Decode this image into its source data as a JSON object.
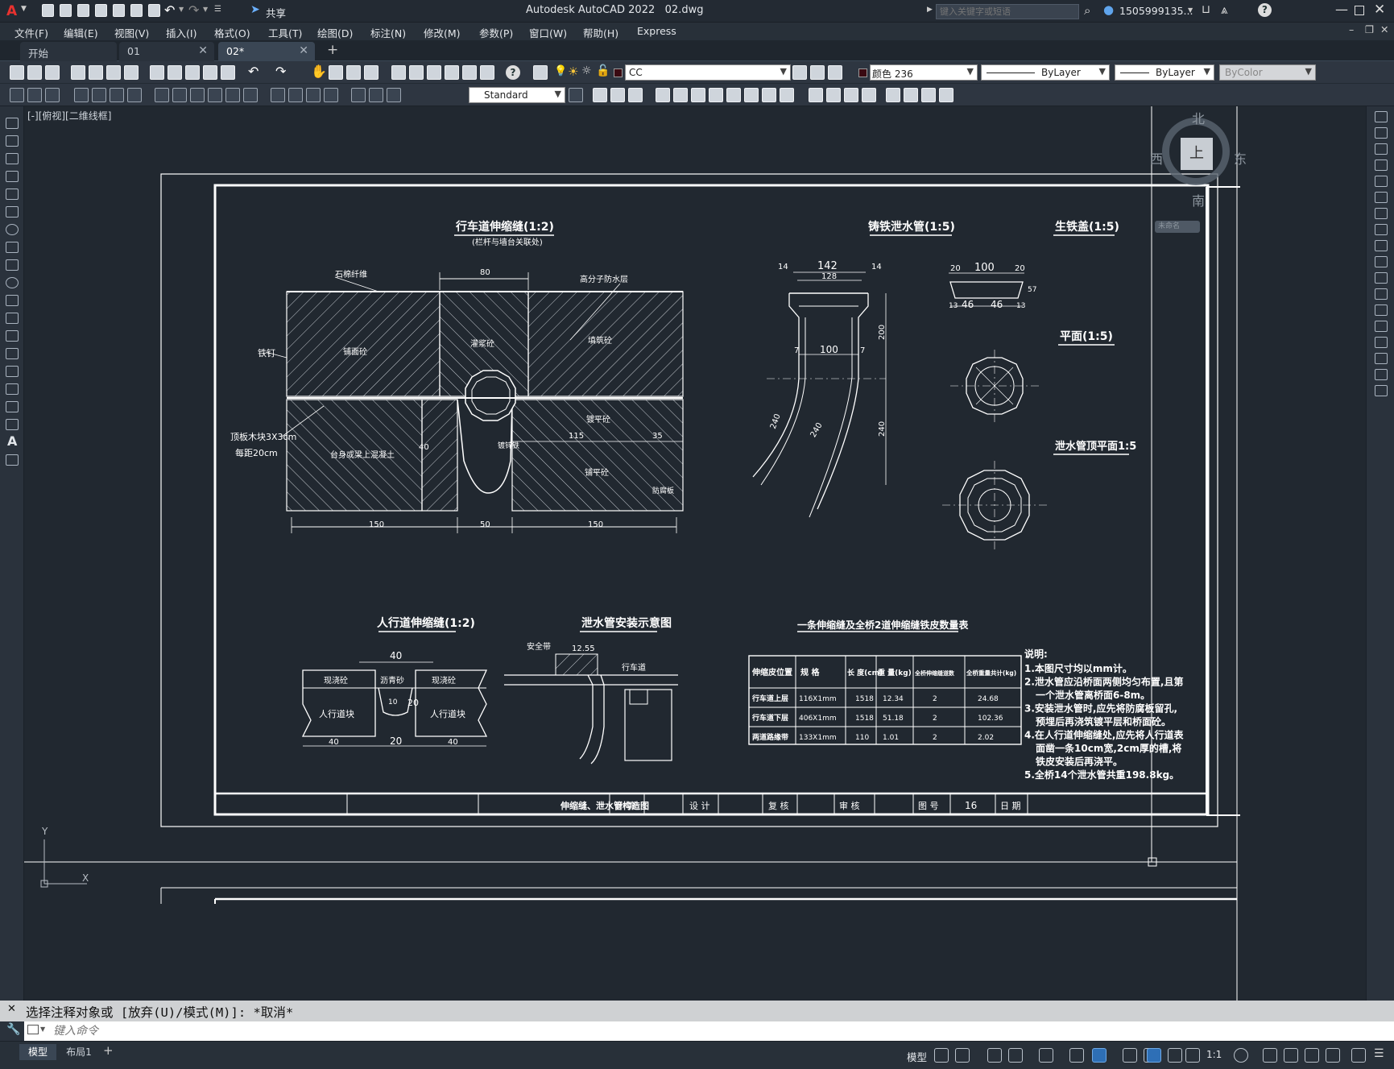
{
  "app": {
    "title": "Autodesk AutoCAD 2022",
    "file": "02.dwg",
    "search_placeholder": "键入关键字或短语",
    "user": "1505999135...",
    "share": "共享"
  },
  "menu": [
    "文件(F)",
    "编辑(E)",
    "视图(V)",
    "插入(I)",
    "格式(O)",
    "工具(T)",
    "绘图(D)",
    "标注(N)",
    "修改(M)",
    "参数(P)",
    "窗口(W)",
    "帮助(H)",
    "Express"
  ],
  "tabs": [
    {
      "label": "开始"
    },
    {
      "label": "01"
    },
    {
      "label": "02*"
    }
  ],
  "toolbar": {
    "layer": "CC",
    "color": "颜色 236",
    "linetype": "ByLayer",
    "lineweight": "ByLayer",
    "plotstyle": "ByColor",
    "textstyle": "Standard"
  },
  "viewport_label": "[-][俯视][二维线框]",
  "viewcube": {
    "n": "北",
    "s": "南",
    "e": "东",
    "w": "西",
    "top": "上",
    "wcs": "未命名"
  },
  "drawing": {
    "main_title": "行车道伸缩缝(1:2)",
    "main_sub": "(栏杆与墙台关联处)",
    "labels": {
      "asbestos": "石棉纤维",
      "polymer": "高分子防水层",
      "steel_nail": "铁钉",
      "top_pave": "铺面砼",
      "pouring": "灌浆砼",
      "fill": "填筑砼",
      "wood": "顶板木块3X3cm",
      "wood2": "每距20cm",
      "abutment": "台身或梁上混凝土",
      "water_steel": "镀锌铁",
      "lean": "镀平砼",
      "paving": "铺平砼",
      "anti": "防腐板"
    },
    "dims_main": {
      "top": "80",
      "l": "150",
      "m": "50",
      "r": "150",
      "d115": "115",
      "d35": "35",
      "d40": "40"
    },
    "pipe_title": "铸铁泄水管(1:5)",
    "pipe_dims": {
      "w142": "142",
      "w128": "128",
      "d14a": "14",
      "d14b": "14",
      "d100": "100",
      "d7a": "7",
      "d7b": "7",
      "h200": "200",
      "h240": "240",
      "s240a": "240",
      "s240b": "240"
    },
    "cover_title": "生铁盖(1:5)",
    "cover_dims": {
      "w100": "100",
      "w20a": "20",
      "w20b": "20",
      "w46a": "46",
      "w46b": "46",
      "h13a": "13",
      "h13b": "13",
      "h57": "57"
    },
    "plan_title": "平面(1:5)",
    "top_plan_title": "泄水管顶平面1:5",
    "sidewalk_title": "人行道伸缩缝(1:2)",
    "sw_labels": {
      "l": "现浇砼",
      "m": "沥青砂",
      "r": "现浇砼",
      "lw": "人行道块",
      "rw": "人行道块"
    },
    "sw_dims": {
      "t40": "40",
      "b40a": "40",
      "b20": "20",
      "b40b": "40",
      "h20": "20",
      "h10": "10"
    },
    "install_title": "泄水管安装示意图",
    "install_labels": {
      "guard": "安全带",
      "road": "行车道",
      "d1255": "12.55"
    },
    "table": {
      "title": "一条伸缩缝及全桥2道伸缩缝铁皮数量表",
      "headers": [
        "伸缩皮位置",
        "规 格",
        "长 度(cm)",
        "重 量(kg)",
        "全桥伸缩缝道数",
        "全桥重量共计(kg)"
      ],
      "rows": [
        [
          "行车道上层",
          "116X1mm",
          "1518",
          "12.34",
          "2",
          "24.68"
        ],
        [
          "行车道下层",
          "406X1mm",
          "1518",
          "51.18",
          "2",
          "102.36"
        ],
        [
          "两道路缘带",
          "133X1mm",
          "110",
          "1.01",
          "2",
          "2.02"
        ]
      ]
    },
    "notes_title": "说明:",
    "notes": [
      "1.本图尺寸均以mm计。",
      "2.泄水管应沿桥面两侧均匀布置,且第",
      "一个泄水管离桥面6-8m。",
      "3.安装泄水管时,应先将防腐板留孔,",
      "预埋后再浇筑镀平层和桥面砼。",
      "4.在人行道伸缩缝处,应先将人行道表",
      "面凿一条10cm宽,2cm厚的槽,将",
      "铁皮安装后再浇平。",
      "5.全桥14个泄水管共重198.8kg。"
    ],
    "titleblock": {
      "name": "伸缩缝、泄水管构造图",
      "calc": "计 算",
      "design": "设 计",
      "review": "复 核",
      "check": "审 核",
      "drawno_label": "图 号",
      "drawno": "16",
      "date": "日 期"
    }
  },
  "command": {
    "history": "选择注释对象或 [放弃(U)/模式(M)]: *取消*",
    "placeholder": "键入命令"
  },
  "status": {
    "model_tab": "模型",
    "layout_tab": "布局1",
    "model": "模型",
    "scale": "1:1"
  }
}
